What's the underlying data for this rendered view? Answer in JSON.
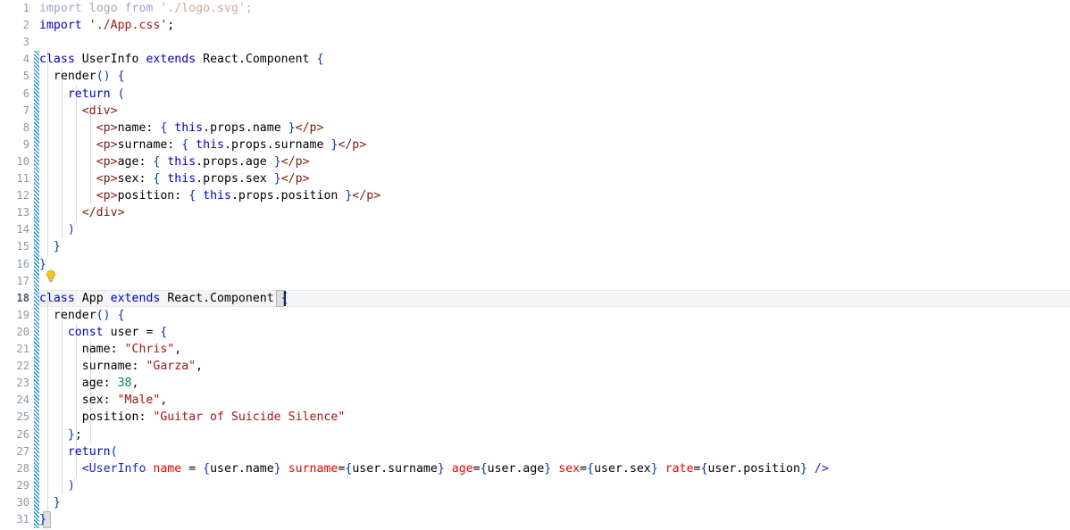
{
  "editor": {
    "language": "javascript-jsx",
    "file_kind": "React component source",
    "total_lines": 31,
    "current_line": 18,
    "background_color": "#ffffff",
    "current_line_highlight_color": "#f4f5f7",
    "line_number_color": "#8a9aa8",
    "vcs_stripe_color": "#2e95d3",
    "vcs_changed_from_line": 4,
    "vcs_changed_to_line": 30,
    "intention_bulb_line": 17,
    "colors": {
      "keyword": "#0000c0",
      "string": "#a31515",
      "number": "#098658",
      "jsx_tag": "#7d1a13",
      "jsx_attribute": "#ee0000",
      "brace": "#0033b3",
      "identifier": "#000000",
      "faded_identifier": "#a9a9a9"
    },
    "line_numbers": [
      "1",
      "2",
      "3",
      "4",
      "5",
      "6",
      "7",
      "8",
      "9",
      "10",
      "11",
      "12",
      "13",
      "14",
      "15",
      "16",
      "17",
      "18",
      "19",
      "20",
      "21",
      "22",
      "23",
      "24",
      "25",
      "26",
      "27",
      "28",
      "29",
      "30",
      "31"
    ],
    "lines": [
      {
        "n": 1,
        "indent": 0,
        "faded": true,
        "text": "import logo from './logo.svg';"
      },
      {
        "n": 2,
        "indent": 0,
        "faded": false,
        "text": "import './App.css';"
      },
      {
        "n": 3,
        "indent": 0,
        "faded": false,
        "text": ""
      },
      {
        "n": 4,
        "indent": 0,
        "faded": false,
        "text": "class UserInfo extends React.Component {"
      },
      {
        "n": 5,
        "indent": 1,
        "faded": false,
        "text": "  render() {"
      },
      {
        "n": 6,
        "indent": 2,
        "faded": false,
        "text": "    return ("
      },
      {
        "n": 7,
        "indent": 3,
        "faded": false,
        "text": "      <div>"
      },
      {
        "n": 8,
        "indent": 4,
        "faded": false,
        "text": "        <p>name: { this.props.name }</p>"
      },
      {
        "n": 9,
        "indent": 4,
        "faded": false,
        "text": "        <p>surname: { this.props.surname }</p>"
      },
      {
        "n": 10,
        "indent": 4,
        "faded": false,
        "text": "        <p>age: { this.props.age }</p>"
      },
      {
        "n": 11,
        "indent": 4,
        "faded": false,
        "text": "        <p>sex: { this.props.sex }</p>"
      },
      {
        "n": 12,
        "indent": 4,
        "faded": false,
        "text": "        <p>position: { this.props.position }</p>"
      },
      {
        "n": 13,
        "indent": 3,
        "faded": false,
        "text": "      </div>"
      },
      {
        "n": 14,
        "indent": 2,
        "faded": false,
        "text": "    )"
      },
      {
        "n": 15,
        "indent": 1,
        "faded": false,
        "text": "  }"
      },
      {
        "n": 16,
        "indent": 0,
        "faded": false,
        "text": "}"
      },
      {
        "n": 17,
        "indent": 0,
        "faded": false,
        "text": ""
      },
      {
        "n": 18,
        "indent": 0,
        "faded": false,
        "text": "class App extends React.Component {"
      },
      {
        "n": 19,
        "indent": 1,
        "faded": false,
        "text": "  render() {"
      },
      {
        "n": 20,
        "indent": 2,
        "faded": false,
        "text": "    const user = {"
      },
      {
        "n": 21,
        "indent": 3,
        "faded": false,
        "text": "      name: \"Chris\","
      },
      {
        "n": 22,
        "indent": 3,
        "faded": false,
        "text": "      surname: \"Garza\","
      },
      {
        "n": 23,
        "indent": 3,
        "faded": false,
        "text": "      age: 38,"
      },
      {
        "n": 24,
        "indent": 3,
        "faded": false,
        "text": "      sex: \"Male\","
      },
      {
        "n": 25,
        "indent": 3,
        "faded": false,
        "text": "      position: \"Guitar of Suicide Silence\""
      },
      {
        "n": 26,
        "indent": 2,
        "faded": false,
        "text": "    };"
      },
      {
        "n": 27,
        "indent": 2,
        "faded": false,
        "text": "    return("
      },
      {
        "n": 28,
        "indent": 3,
        "faded": false,
        "text": "      <UserInfo name = {user.name} surname={user.surname} age={user.age} sex={user.sex} rate={user.position} />"
      },
      {
        "n": 29,
        "indent": 2,
        "faded": false,
        "text": "    )"
      },
      {
        "n": 30,
        "indent": 1,
        "faded": false,
        "text": "  }"
      },
      {
        "n": 31,
        "indent": 0,
        "faded": false,
        "text": "}"
      }
    ],
    "code_values": {
      "user_object": {
        "name": "Chris",
        "surname": "Garza",
        "age": "38",
        "sex": "Male",
        "position": "Guitar of Suicide Silence"
      },
      "imports": [
        "./logo.svg",
        "./App.css"
      ],
      "classes": [
        "UserInfo",
        "App"
      ],
      "base_class": "React.Component",
      "jsx_props": [
        "name",
        "surname",
        "age",
        "sex",
        "rate"
      ]
    }
  }
}
